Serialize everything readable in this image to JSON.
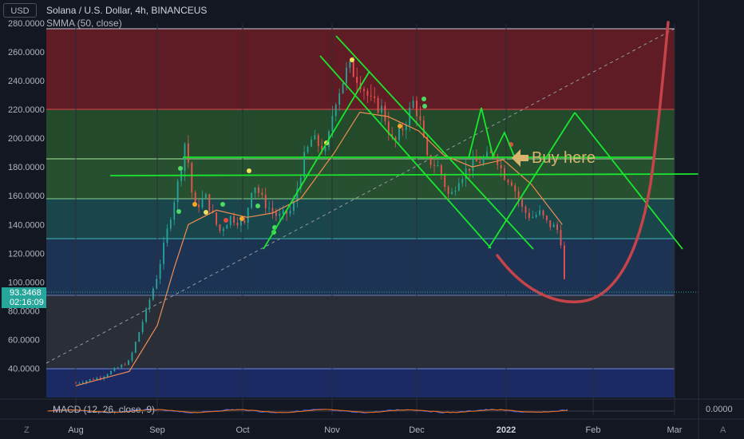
{
  "header": {
    "currency_badge": "USD",
    "title": "Solana / U.S. Dollar, 4h, BINANCEUS",
    "indicator": "SMMA (50, close)"
  },
  "price_axis": {
    "labels": [
      "280.0000",
      "260.0000",
      "240.0000",
      "220.0000",
      "200.0000",
      "180.0000",
      "160.0000",
      "140.0000",
      "120.0000",
      "100.0000",
      "80.0000",
      "60.0000",
      "40.0000"
    ]
  },
  "last_price": {
    "value": "93.3468",
    "countdown": "02:16:09"
  },
  "time_axis": {
    "labels": [
      "Aug",
      "Sep",
      "Oct",
      "Nov",
      "Dec",
      "2022",
      "Feb",
      "Mar"
    ]
  },
  "macd": {
    "label": "MACD (12, 26, close, 9)",
    "zero": "0.0000"
  },
  "annotation": {
    "text": "Buy here",
    "arrow_icon": "left-arrow-icon"
  },
  "bottom_icons": {
    "left": "Z",
    "right": "A"
  },
  "colors": {
    "background": "#131722",
    "zone_red": "#7a1f27",
    "zone_green": "#27542d",
    "zone_teal": "#1c4a4f",
    "zone_blue": "#1d3556",
    "zone_gray": "#2a2e39",
    "zone_navy": "#1c2a63",
    "trendline": "#19e62d",
    "smma": "#f08d50",
    "forecast_curve": "#c6434a",
    "annotation": "#d8b46e",
    "last_price_bg": "#26a69a"
  },
  "chart_data": {
    "type": "candlestick",
    "symbol": "SOLUSD",
    "interval": "4h",
    "ylim": [
      20,
      290
    ],
    "y_ticks": [
      280,
      260,
      240,
      220,
      200,
      180,
      160,
      140,
      120,
      100,
      80,
      60,
      40
    ],
    "x_labels": [
      "Aug",
      "Sep",
      "Oct",
      "Nov",
      "Dec",
      "2022",
      "Feb",
      "Mar"
    ],
    "zones": [
      {
        "from": 220,
        "to": 276,
        "color": "red"
      },
      {
        "from": 186,
        "to": 220,
        "color": "green"
      },
      {
        "from": 158,
        "to": 186,
        "color": "green"
      },
      {
        "from": 130,
        "to": 158,
        "color": "teal"
      },
      {
        "from": 90,
        "to": 130,
        "color": "blue"
      },
      {
        "from": 40,
        "to": 90,
        "color": "gray"
      },
      {
        "from": 20,
        "to": 40,
        "color": "navy"
      }
    ],
    "price_path": [
      [
        "Aug 01",
        30
      ],
      [
        "Aug 10",
        34
      ],
      [
        "Aug 20",
        45
      ],
      [
        "Aug 26",
        80
      ],
      [
        "Aug 30",
        105
      ],
      [
        "Sep 03",
        140
      ],
      [
        "Sep 07",
        175
      ],
      [
        "Sep 09",
        200
      ],
      [
        "Sep 12",
        150
      ],
      [
        "Sep 16",
        160
      ],
      [
        "Sep 21",
        135
      ],
      [
        "Sep 25",
        145
      ],
      [
        "Sep 30",
        140
      ],
      [
        "Oct 03",
        170
      ],
      [
        "Oct 07",
        155
      ],
      [
        "Oct 12",
        145
      ],
      [
        "Oct 17",
        150
      ],
      [
        "Oct 21",
        185
      ],
      [
        "Oct 24",
        200
      ],
      [
        "Oct 29",
        190
      ],
      [
        "Nov 01",
        225
      ],
      [
        "Nov 06",
        250
      ],
      [
        "Nov 10",
        240
      ],
      [
        "Nov 14",
        225
      ],
      [
        "Nov 18",
        220
      ],
      [
        "Nov 22",
        195
      ],
      [
        "Nov 26",
        210
      ],
      [
        "Nov 29",
        225
      ],
      [
        "Dec 01",
        215
      ],
      [
        "Dec 04",
        185
      ],
      [
        "Dec 08",
        180
      ],
      [
        "Dec 12",
        158
      ],
      [
        "Dec 15",
        172
      ],
      [
        "Dec 20",
        182
      ],
      [
        "Dec 24",
        185
      ],
      [
        "Dec 28",
        190
      ],
      [
        "Dec 31",
        175
      ],
      [
        "Jan 03",
        170
      ],
      [
        "Jan 07",
        150
      ],
      [
        "Jan 10",
        145
      ],
      [
        "Jan 13",
        148
      ],
      [
        "Jan 16",
        140
      ],
      [
        "Jan 19",
        138
      ],
      [
        "Jan 21",
        125
      ],
      [
        "Jan 22",
        93.35
      ]
    ],
    "smma_path": [
      [
        "Aug 01",
        28
      ],
      [
        "Aug 20",
        38
      ],
      [
        "Aug 30",
        70
      ],
      [
        "Sep 05",
        110
      ],
      [
        "Sep 10",
        140
      ],
      [
        "Sep 20",
        150
      ],
      [
        "Oct 01",
        145
      ],
      [
        "Oct 10",
        148
      ],
      [
        "Oct 20",
        158
      ],
      [
        "Nov 01",
        190
      ],
      [
        "Nov 10",
        218
      ],
      [
        "Nov 20",
        215
      ],
      [
        "Dec 01",
        205
      ],
      [
        "Dec 10",
        188
      ],
      [
        "Dec 20",
        180
      ],
      [
        "Dec 31",
        185
      ],
      [
        "Jan 10",
        168
      ],
      [
        "Jan 21",
        140
      ]
    ],
    "last_price": 93.3468
  }
}
